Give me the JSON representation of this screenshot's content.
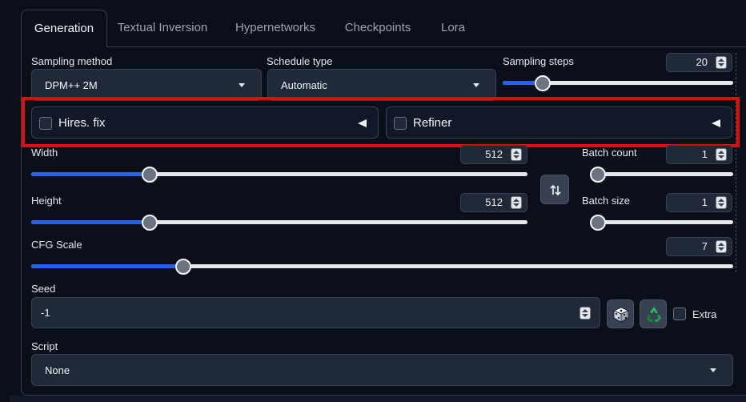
{
  "tabs": [
    {
      "label": "Generation",
      "active": true
    },
    {
      "label": "Textual Inversion",
      "active": false
    },
    {
      "label": "Hypernetworks",
      "active": false
    },
    {
      "label": "Checkpoints",
      "active": false
    },
    {
      "label": "Lora",
      "active": false
    }
  ],
  "sampling_method": {
    "label": "Sampling method",
    "value": "DPM++ 2M"
  },
  "schedule_type": {
    "label": "Schedule type",
    "value": "Automatic"
  },
  "sampling_steps": {
    "label": "Sampling steps",
    "value": "20",
    "fill_fraction": 0.15
  },
  "hires_fix": {
    "label": "Hires. fix",
    "checked": false
  },
  "refiner": {
    "label": "Refiner",
    "checked": false
  },
  "width": {
    "label": "Width",
    "value": "512",
    "fill_fraction": 0.23
  },
  "height": {
    "label": "Height",
    "value": "512",
    "fill_fraction": 0.23
  },
  "batch_count": {
    "label": "Batch count",
    "value": "1",
    "fill_fraction": 0.0
  },
  "batch_size": {
    "label": "Batch size",
    "value": "1",
    "fill_fraction": 0.0
  },
  "cfg_scale": {
    "label": "CFG Scale",
    "value": "7",
    "fill_fraction": 0.21
  },
  "seed": {
    "label": "Seed",
    "value": "-1",
    "extra_label": "Extra"
  },
  "script": {
    "label": "Script",
    "value": "None"
  },
  "icons": {
    "swap": "swap-dimensions-icon",
    "dice": "dice-icon",
    "recycle": "recycle-icon"
  },
  "colors": {
    "accent": "#2563eb",
    "highlight_border": "#e10c0c",
    "background": "#0b0f19"
  }
}
